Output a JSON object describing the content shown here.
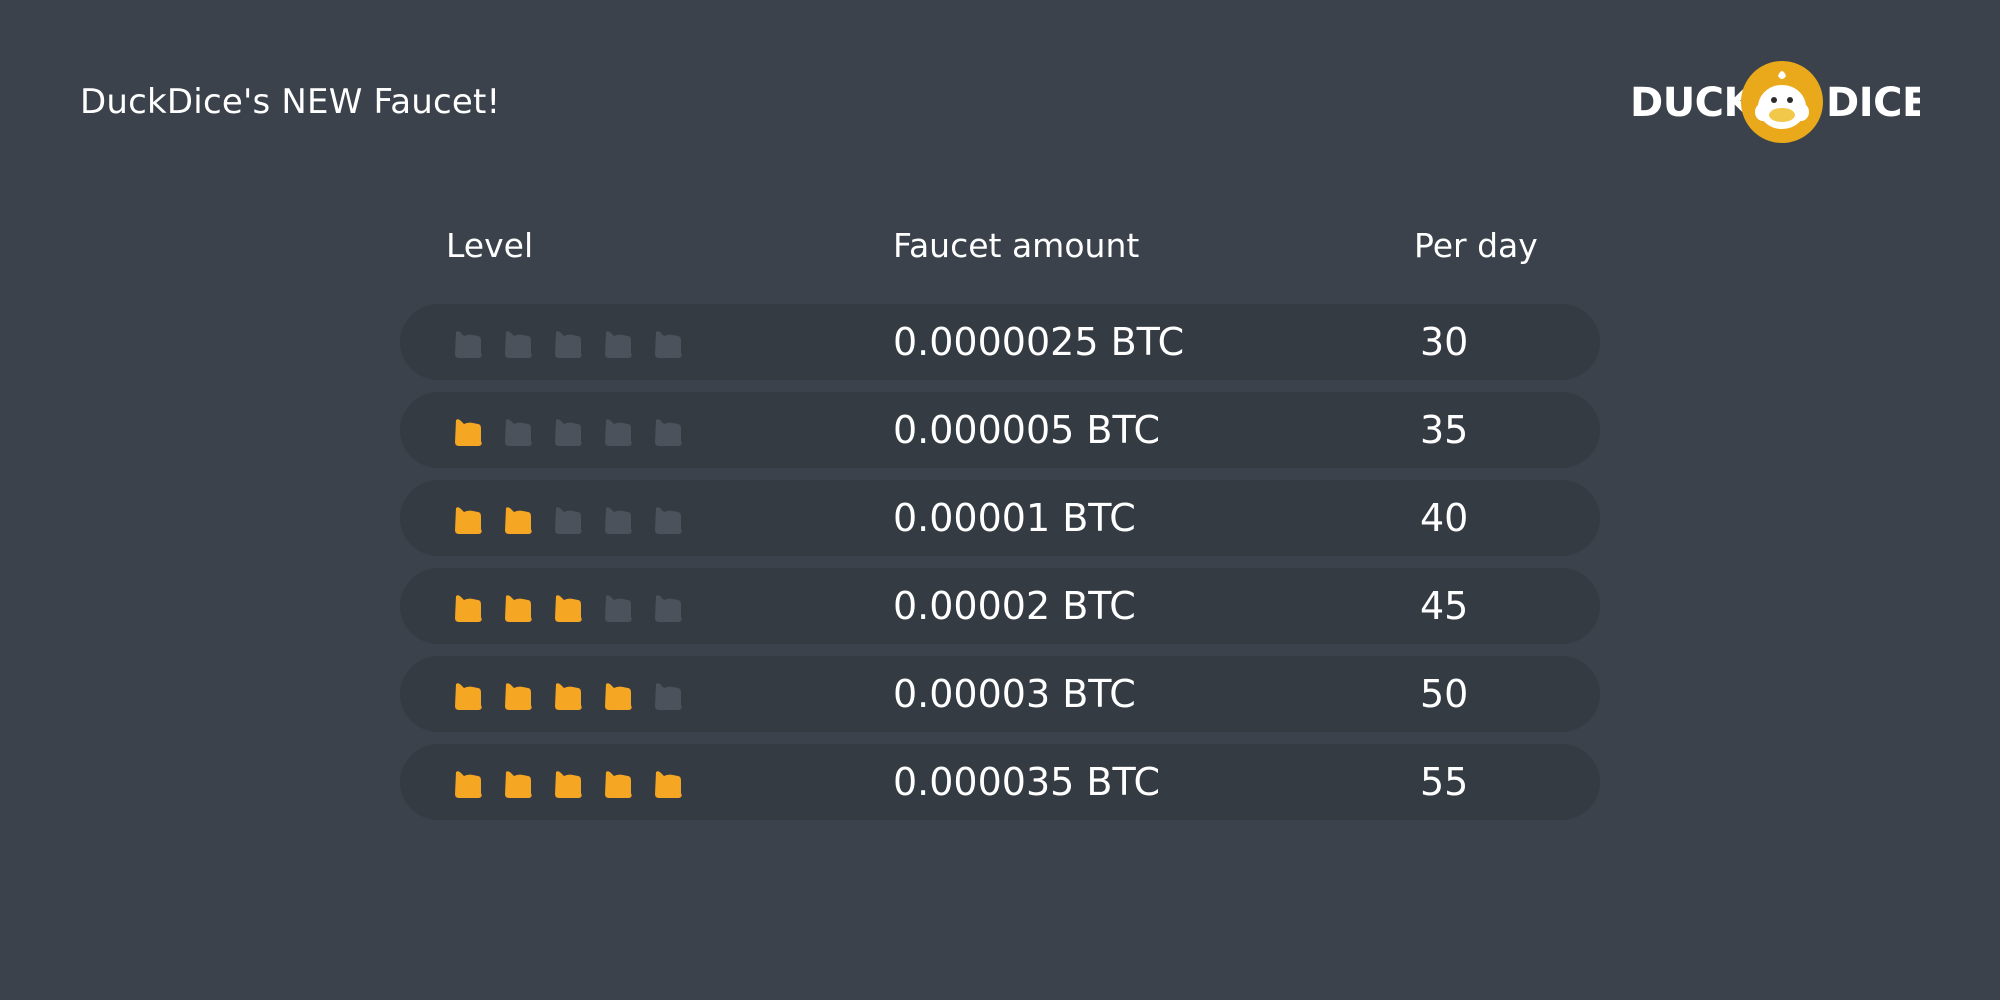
{
  "header": {
    "title": "DuckDice's NEW Faucet!",
    "logo": {
      "left_text": "DUCK",
      "right_text": "DICE",
      "badge_color": "#e9a91a",
      "icon": "duck-face-icon"
    }
  },
  "table": {
    "columns": [
      "Level",
      "Faucet amount",
      "Per day"
    ],
    "rows": [
      {
        "level": 0,
        "max_level": 5,
        "amount": "0.0000025 BTC",
        "per_day": "30"
      },
      {
        "level": 1,
        "max_level": 5,
        "amount": "0.000005 BTC",
        "per_day": "35"
      },
      {
        "level": 2,
        "max_level": 5,
        "amount": "0.00001 BTC",
        "per_day": "40"
      },
      {
        "level": 3,
        "max_level": 5,
        "amount": "0.00002 BTC",
        "per_day": "45"
      },
      {
        "level": 4,
        "max_level": 5,
        "amount": "0.00003 BTC",
        "per_day": "50"
      },
      {
        "level": 5,
        "max_level": 5,
        "amount": "0.000035 BTC",
        "per_day": "55"
      }
    ],
    "level_icon": "duck-level-icon",
    "active_color": "#f5a623",
    "inactive_color": "#4b525b"
  }
}
